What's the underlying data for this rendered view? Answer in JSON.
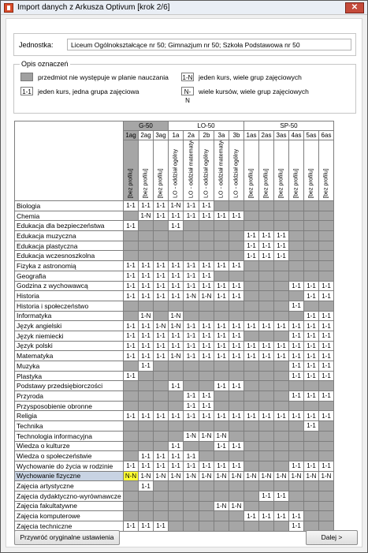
{
  "window": {
    "title": "Import danych z Arkusza Optivum [krok 2/6]",
    "close_symbol": "✕"
  },
  "jednostka": {
    "label": "Jednostka:",
    "value": "Liceum Ogólnokształcące nr 50; Gimnazjum nr 50; Szkoła Podstawowa nr 50"
  },
  "legend": {
    "title": "Opis oznaczeń",
    "items": [
      {
        "symbol": "",
        "text": "przedmiot nie występuje w planie nauczania"
      },
      {
        "symbol": "1-N",
        "text": "jeden kurs, wiele grup zajęciowych"
      },
      {
        "symbol": "1-1",
        "text": "jeden kurs, jedna grupa zajęciowa"
      },
      {
        "symbol": "N-N",
        "text": "wiele kursów, wiele grup zajęciowych"
      }
    ]
  },
  "groups": [
    {
      "name": "G-50",
      "span": 3
    },
    {
      "name": "LO-50",
      "span": 5
    },
    {
      "name": "SP-50",
      "span": 6
    }
  ],
  "classes": [
    "1ag",
    "2ag",
    "3ag",
    "1a",
    "2a",
    "2b",
    "3a",
    "3b",
    "1as",
    "2as",
    "3as",
    "4as",
    "5as",
    "6as"
  ],
  "profiles": [
    "[bez profilu]",
    "[bez profilu]",
    "[bez profilu]",
    "LO - oddział ogólny",
    "LO - oddział matematyczny",
    "LO - oddział ogólny",
    "LO - oddział matematyczny",
    "LO - oddział ogólny",
    "[bez profilu]",
    "[bez profilu]",
    "[bez profilu]",
    "[bez profilu]",
    "[bez profilu]",
    "[bez profilu]"
  ],
  "rows": [
    {
      "subject": "Biologia",
      "cells": [
        "1-1",
        "1-1",
        "1-1",
        "1-N",
        "1-1",
        "1-1",
        "",
        "",
        "",
        "",
        "",
        "",
        "",
        ""
      ]
    },
    {
      "subject": "Chemia",
      "cells": [
        "",
        "1-N",
        "1-1",
        "1-1",
        "1-1",
        "1-1",
        "1-1",
        "1-1",
        "",
        "",
        "",
        "",
        "",
        ""
      ]
    },
    {
      "subject": "Edukacja dla bezpieczeństwa",
      "cells": [
        "1-1",
        "",
        "",
        "1-1",
        "",
        "",
        "",
        "",
        "",
        "",
        "",
        "",
        "",
        ""
      ]
    },
    {
      "subject": "Edukacja muzyczna",
      "cells": [
        "",
        "",
        "",
        "",
        "",
        "",
        "",
        "",
        "1-1",
        "1-1",
        "1-1",
        "",
        "",
        ""
      ]
    },
    {
      "subject": "Edukacja plastyczna",
      "cells": [
        "",
        "",
        "",
        "",
        "",
        "",
        "",
        "",
        "1-1",
        "1-1",
        "1-1",
        "",
        "",
        ""
      ]
    },
    {
      "subject": "Edukacja wczesnoszkolna",
      "cells": [
        "",
        "",
        "",
        "",
        "",
        "",
        "",
        "",
        "1-1",
        "1-1",
        "1-1",
        "",
        "",
        ""
      ]
    },
    {
      "subject": "Fizyka z astronomią",
      "cells": [
        "1-1",
        "1-1",
        "1-1",
        "1-1",
        "1-1",
        "1-1",
        "1-1",
        "1-1",
        "",
        "",
        "",
        "",
        "",
        ""
      ]
    },
    {
      "subject": "Geografia",
      "cells": [
        "1-1",
        "1-1",
        "1-1",
        "1-1",
        "1-1",
        "1-1",
        "",
        "",
        "",
        "",
        "",
        "",
        "",
        ""
      ]
    },
    {
      "subject": "Godzina z wychowawcą",
      "cells": [
        "1-1",
        "1-1",
        "1-1",
        "1-1",
        "1-1",
        "1-1",
        "1-1",
        "1-1",
        "",
        "",
        "",
        "1-1",
        "1-1",
        "1-1"
      ]
    },
    {
      "subject": "Historia",
      "cells": [
        "1-1",
        "1-1",
        "1-1",
        "1-1",
        "1-N",
        "1-N",
        "1-1",
        "1-1",
        "",
        "",
        "",
        "",
        "1-1",
        "1-1"
      ]
    },
    {
      "subject": "Historia i społeczeństwo",
      "cells": [
        "",
        "",
        "",
        "",
        "",
        "",
        "",
        "",
        "",
        "",
        "",
        "1-1",
        "",
        ""
      ]
    },
    {
      "subject": "Informatyka",
      "cells": [
        "",
        "1-N",
        "",
        "1-N",
        "",
        "",
        "",
        "",
        "",
        "",
        "",
        "",
        "1-1",
        "1-1"
      ]
    },
    {
      "subject": "Język angielski",
      "cells": [
        "1-1",
        "1-1",
        "1-N",
        "1-N",
        "1-1",
        "1-1",
        "1-1",
        "1-1",
        "1-1",
        "1-1",
        "1-1",
        "1-1",
        "1-1",
        "1-1"
      ]
    },
    {
      "subject": "Język niemiecki",
      "cells": [
        "1-1",
        "1-1",
        "1-1",
        "1-1",
        "1-1",
        "1-1",
        "1-1",
        "1-1",
        "",
        "",
        "",
        "1-1",
        "1-1",
        "1-1"
      ]
    },
    {
      "subject": "Język polski",
      "cells": [
        "1-1",
        "1-1",
        "1-1",
        "1-1",
        "1-1",
        "1-1",
        "1-1",
        "1-1",
        "1-1",
        "1-1",
        "1-1",
        "1-1",
        "1-1",
        "1-1"
      ]
    },
    {
      "subject": "Matematyka",
      "cells": [
        "1-1",
        "1-1",
        "1-1",
        "1-N",
        "1-1",
        "1-1",
        "1-1",
        "1-1",
        "1-1",
        "1-1",
        "1-1",
        "1-1",
        "1-1",
        "1-1"
      ]
    },
    {
      "subject": "Muzyka",
      "cells": [
        "",
        "1-1",
        "",
        "",
        "",
        "",
        "",
        "",
        "",
        "",
        "",
        "1-1",
        "1-1",
        "1-1"
      ]
    },
    {
      "subject": "Plastyka",
      "cells": [
        "1-1",
        "",
        "",
        "",
        "",
        "",
        "",
        "",
        "",
        "",
        "",
        "1-1",
        "1-1",
        "1-1"
      ]
    },
    {
      "subject": "Podstawy przedsiębiorczości",
      "cells": [
        "",
        "",
        "",
        "1-1",
        "",
        "",
        "1-1",
        "1-1",
        "",
        "",
        "",
        "",
        "",
        ""
      ]
    },
    {
      "subject": "Przyroda",
      "cells": [
        "",
        "",
        "",
        "",
        "1-1",
        "1-1",
        "",
        "",
        "",
        "",
        "",
        "1-1",
        "1-1",
        "1-1"
      ]
    },
    {
      "subject": "Przysposobienie obronne",
      "cells": [
        "",
        "",
        "",
        "",
        "1-1",
        "1-1",
        "",
        "",
        "",
        "",
        "",
        "",
        "",
        ""
      ]
    },
    {
      "subject": "Religia",
      "cells": [
        "1-1",
        "1-1",
        "1-1",
        "1-1",
        "1-1",
        "1-1",
        "1-1",
        "1-1",
        "1-1",
        "1-1",
        "1-1",
        "1-1",
        "1-1",
        "1-1"
      ]
    },
    {
      "subject": "Technika",
      "cells": [
        "",
        "",
        "",
        "",
        "",
        "",
        "",
        "",
        "",
        "",
        "",
        "",
        "1-1",
        ""
      ]
    },
    {
      "subject": "Technologia informacyjna",
      "cells": [
        "",
        "",
        "",
        "",
        "1-N",
        "1-N",
        "1-N",
        "",
        "",
        "",
        "",
        "",
        "",
        ""
      ]
    },
    {
      "subject": "Wiedza o kulturze",
      "cells": [
        "",
        "",
        "",
        "1-1",
        "",
        "",
        "1-1",
        "1-1",
        "",
        "",
        "",
        "",
        "",
        ""
      ]
    },
    {
      "subject": "Wiedza o społeczeństwie",
      "cells": [
        "",
        "1-1",
        "1-1",
        "1-1",
        "1-1",
        "",
        "",
        "",
        "",
        "",
        "",
        "",
        "",
        ""
      ]
    },
    {
      "subject": "Wychowanie do życia w rodzinie",
      "cells": [
        "1-1",
        "1-1",
        "1-1",
        "1-1",
        "1-1",
        "1-1",
        "1-1",
        "1-1",
        "",
        "",
        "",
        "1-1",
        "1-1",
        "1-1"
      ]
    },
    {
      "subject": "Wychowanie fizyczne",
      "selected": true,
      "cells": [
        "N-N",
        "1-N",
        "1-N",
        "1-N",
        "1-N",
        "1-N",
        "1-N",
        "1-N",
        "1-N",
        "1-N",
        "1-N",
        "1-N",
        "1-N",
        "1-N"
      ]
    },
    {
      "subject": "Zajęcia artystyczne",
      "cells": [
        "",
        "1-1",
        "",
        "",
        "",
        "",
        "",
        "",
        "",
        "",
        "",
        "",
        "",
        ""
      ]
    },
    {
      "subject": "Zajęcia dydaktyczno-wyrównawcze",
      "cells": [
        "",
        "",
        "",
        "",
        "",
        "",
        "",
        "",
        "",
        "1-1",
        "1-1",
        "",
        "",
        ""
      ]
    },
    {
      "subject": "Zajęcia fakultatywne",
      "cells": [
        "",
        "",
        "",
        "",
        "",
        "",
        "1-N",
        "1-N",
        "",
        "",
        "",
        "",
        "",
        ""
      ]
    },
    {
      "subject": "Zajęcia komputerowe",
      "cells": [
        "",
        "",
        "",
        "",
        "",
        "",
        "",
        "",
        "1-1",
        "1-1",
        "1-1",
        "1-1",
        "",
        ""
      ]
    },
    {
      "subject": "Zajęcia techniczne",
      "cells": [
        "1-1",
        "1-1",
        "1-1",
        "",
        "",
        "",
        "",
        "",
        "",
        "",
        "",
        "1-1",
        "",
        ""
      ]
    }
  ],
  "buttons": {
    "reset": "Przywróć oryginalne ustawienia",
    "next": "Dalej >"
  }
}
